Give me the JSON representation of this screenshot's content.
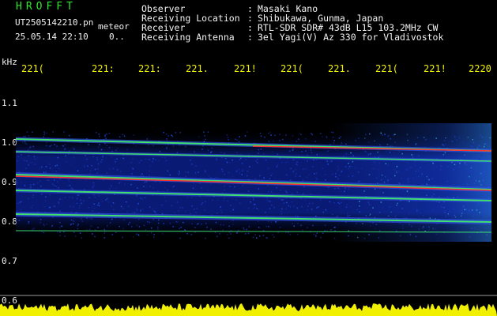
{
  "header": {
    "brand": "HROFFT",
    "file_name": "UT2505142210.pn",
    "meteor_label": "meteor",
    "datetime": "25.05.14 22:10",
    "count": "0.."
  },
  "info": [
    {
      "label": "Observer",
      "sep": ":",
      "value": "Masaki Kano"
    },
    {
      "label": "Receiving Location",
      "sep": ":",
      "value": "Shibukawa, Gunma, Japan"
    },
    {
      "label": "Receiver",
      "sep": ":",
      "value": "RTL-SDR SDR# 43dB L15 103.2MHz CW"
    },
    {
      "label": "Receiving Antenna",
      "sep": ":",
      "value": "3el Yagi(V) Az 330 for Vladivostok"
    }
  ],
  "y_axis": {
    "unit": "kHz",
    "ticks": [
      "1.1",
      "1.0",
      "0.9",
      "0.8",
      "0.7",
      "0.6"
    ]
  },
  "time_ticks": [
    "221(",
    "221:",
    "221:",
    "221.",
    "221!",
    "221(",
    "221.",
    "221(",
    "221!",
    "2220"
  ],
  "colors": {
    "background": "#000000",
    "header_green": "#2fe62f",
    "tick_yellow": "#f0f000",
    "text_white": "#f2f2f2",
    "signal_red": "#ff3030",
    "signal_green": "#40e070",
    "noise_blue": "#1a3cc8"
  }
}
